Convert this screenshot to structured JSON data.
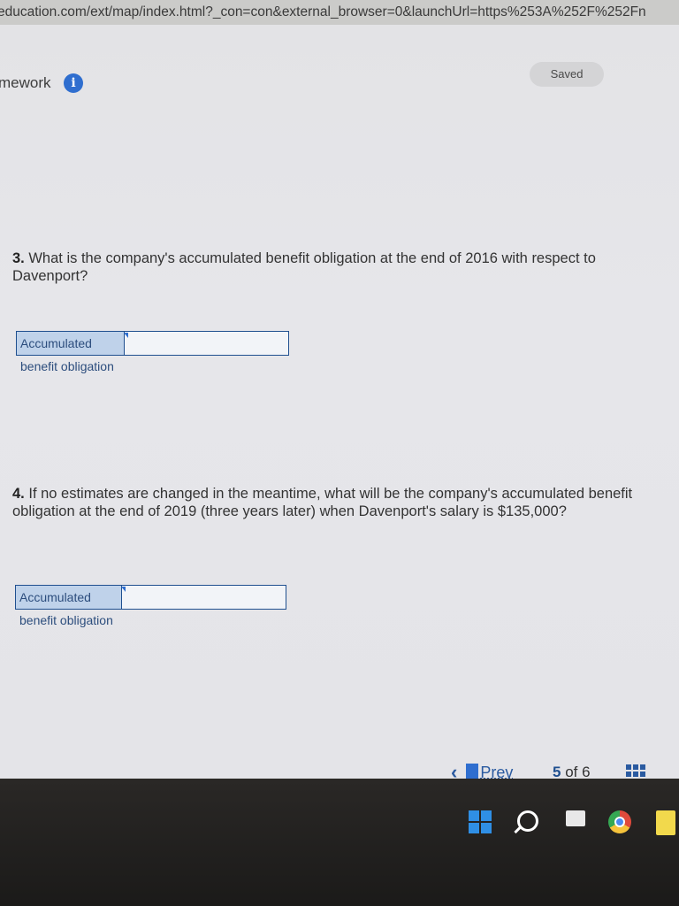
{
  "browser": {
    "url": "education.com/ext/map/index.html?_con=con&external_browser=0&launchUrl=https%253A%252F%252Fn"
  },
  "header": {
    "title": "mework",
    "info_icon": "i",
    "saved_label": "Saved"
  },
  "questions": [
    {
      "number": "3.",
      "text": "What is the company's accumulated benefit obligation at the end of 2016 with respect to Davenport?",
      "answer_label": "Accumulated benefit obligation",
      "answer_value": ""
    },
    {
      "number": "4.",
      "text": "If no estimates are changed in the meantime, what will be the company's accumulated benefit obligation at the end of 2019 (three years later) when Davenport's salary is $135,000?",
      "answer_label": "Accumulated benefit obligation",
      "answer_value": ""
    }
  ],
  "nav": {
    "prev_icon": "‹",
    "prev_label": "Prev",
    "current_page": "5",
    "of_label": "of",
    "total_pages": "6"
  },
  "icons": {
    "windows": "windows-start-icon",
    "search": "search-icon",
    "task_view": "task-view-icon",
    "chrome": "chrome-icon",
    "notes": "notes-icon"
  },
  "colors": {
    "accent": "#2f6ecf",
    "answer_border": "#1f4f8f",
    "answer_label_bg": "#bfd2ea"
  }
}
